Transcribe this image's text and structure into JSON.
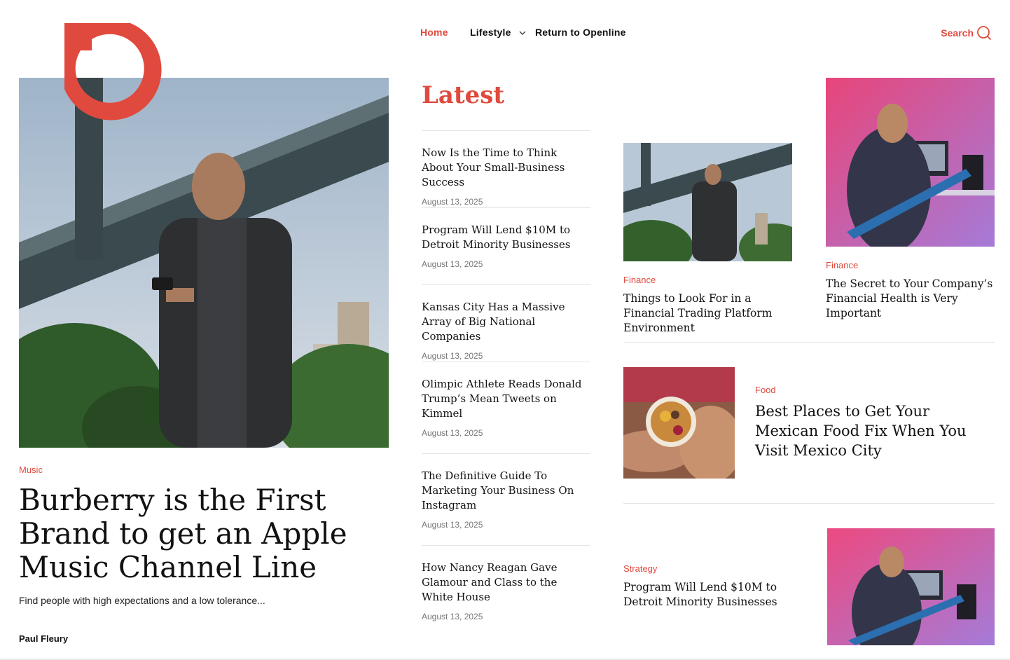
{
  "header": {
    "nav": [
      {
        "label": "Home",
        "active": true
      },
      {
        "label": "Lifestyle",
        "has_dropdown": true
      },
      {
        "label": "Return to Openline"
      }
    ],
    "search_label": "Search"
  },
  "colors": {
    "accent": "#e0493d",
    "text": "#111111",
    "muted": "#777777"
  },
  "hero": {
    "category": "Music",
    "title": "Burberry is the First Brand to get an Apple Music Channel Line",
    "excerpt": "Find people with high expectations and a low tolerance...",
    "author": "Paul Fleury"
  },
  "latest": {
    "heading": "Latest",
    "items": [
      {
        "title": "Now Is the Time to Think About Your Small-Business Success",
        "date": "August 13, 2025"
      },
      {
        "title": "Program Will Lend $10M to Detroit Minority Businesses",
        "date": "August 13, 2025"
      },
      {
        "title": "Kansas City Has a Massive Array of Big National Companies",
        "date": "August 13, 2025"
      },
      {
        "title": "Olimpic Athlete Reads Donald Trump’s Mean Tweets on Kimmel",
        "date": "August 13, 2025"
      },
      {
        "title": "The Definitive Guide To Marketing Your Business On Instagram",
        "date": "August 13, 2025"
      },
      {
        "title": "How Nancy Reagan Gave Glamour and Class to the White House",
        "date": "August 13, 2025"
      }
    ]
  },
  "cards": [
    {
      "category": "Finance",
      "title": "Things to Look For in a Financial Trading Platform Environment"
    },
    {
      "category": "Finance",
      "title": "The Secret to Your Company’s Financial Health is Very Important"
    },
    {
      "category": "Food",
      "title": "Best Places to Get Your Mexican Food Fix When You Visit Mexico City"
    },
    {
      "category": "Strategy",
      "title": "Program Will Lend $10M to Detroit Minority Businesses"
    }
  ]
}
